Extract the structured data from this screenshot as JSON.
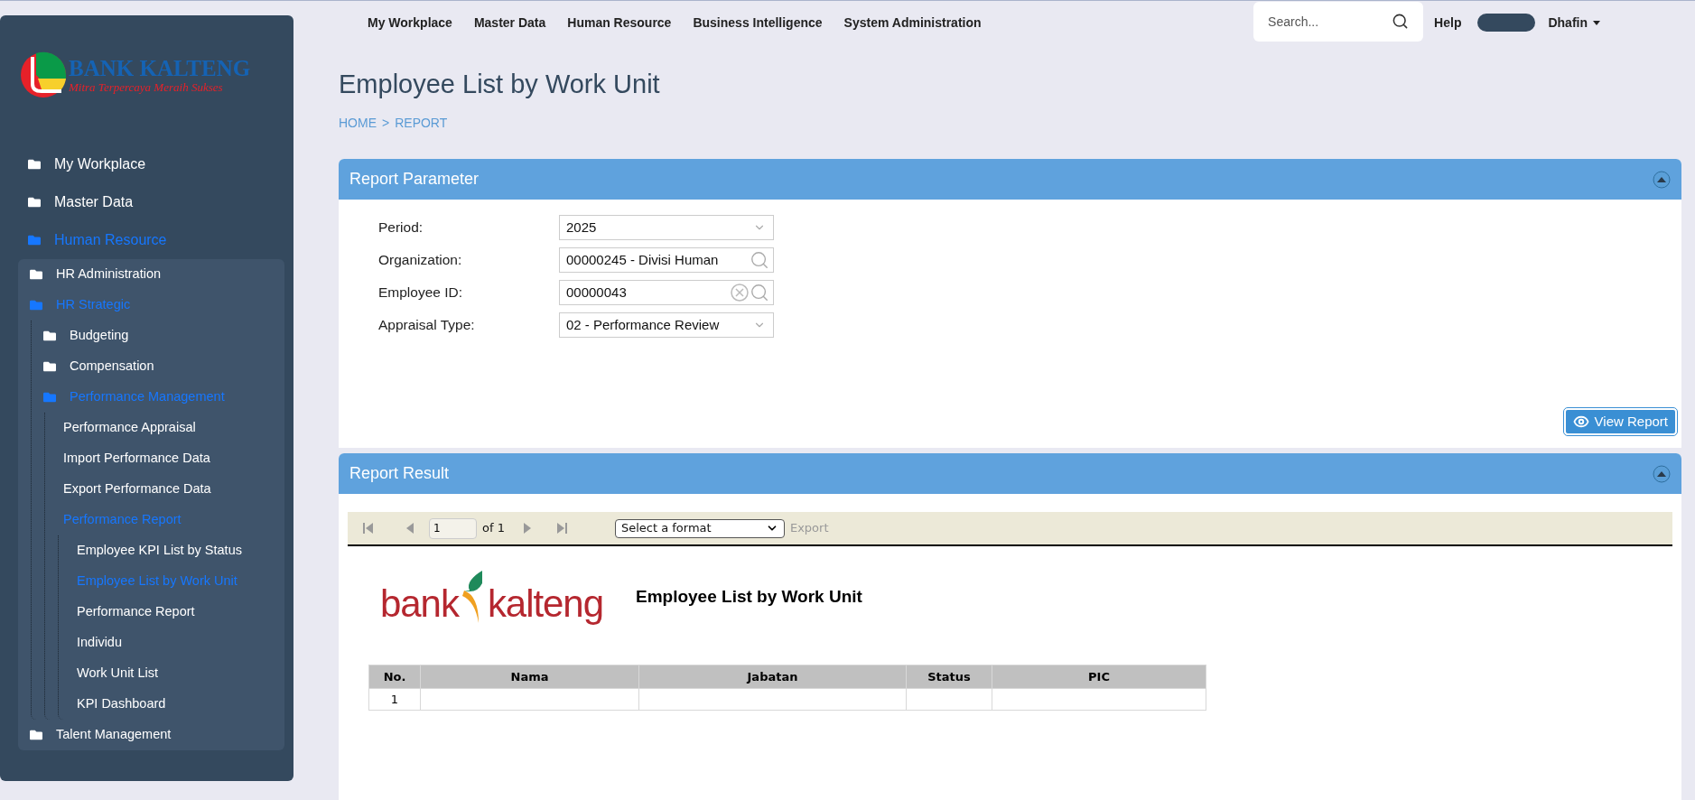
{
  "sidebar": {
    "logo": {
      "name": "BANK KALTENG",
      "tagline": "Mitra Terpercaya Meraih Sukses"
    },
    "items": [
      {
        "label": "My Workplace",
        "kind": "folder",
        "selected": false
      },
      {
        "label": "Master Data",
        "kind": "folder",
        "selected": false
      },
      {
        "label": "Human Resource",
        "kind": "folder",
        "expanded": true,
        "selected": true,
        "children": [
          {
            "label": "HR Administration",
            "kind": "folder",
            "selected": false
          },
          {
            "label": "HR Strategic",
            "kind": "folder",
            "expanded": true,
            "selected": true,
            "children": [
              {
                "label": "Budgeting",
                "kind": "folder",
                "selected": false
              },
              {
                "label": "Compensation",
                "kind": "folder",
                "selected": false
              },
              {
                "label": "Performance Management",
                "kind": "folder",
                "expanded": true,
                "selected": true,
                "children": [
                  {
                    "label": "Performance Appraisal",
                    "kind": "page",
                    "selected": false
                  },
                  {
                    "label": "Import Performance Data",
                    "kind": "page",
                    "selected": false
                  },
                  {
                    "label": "Export Performance Data",
                    "kind": "page",
                    "selected": false
                  },
                  {
                    "label": "Performance Report",
                    "kind": "page",
                    "expanded": true,
                    "selected": true,
                    "children": [
                      {
                        "label": "Employee KPI List by Status",
                        "kind": "page",
                        "selected": false
                      },
                      {
                        "label": "Employee List by Work Unit",
                        "kind": "page",
                        "selected": true
                      },
                      {
                        "label": "Performance Report",
                        "kind": "page",
                        "selected": false
                      },
                      {
                        "label": "Individu",
                        "kind": "page",
                        "selected": false
                      },
                      {
                        "label": "Work Unit List",
                        "kind": "page",
                        "selected": false
                      },
                      {
                        "label": "KPI Dashboard",
                        "kind": "page",
                        "selected": false
                      }
                    ]
                  }
                ]
              }
            ]
          },
          {
            "label": "Talent Management",
            "kind": "folder",
            "selected": false
          }
        ]
      }
    ]
  },
  "top_nav": {
    "items": [
      "My Workplace",
      "Master Data",
      "Human Resource",
      "Business Intelligence",
      "System Administration"
    ],
    "search": {
      "placeholder": "Search..."
    },
    "help": "Help",
    "user": "Dhafin"
  },
  "page": {
    "title": "Employee List by Work Unit",
    "breadcrumb": [
      "HOME",
      "REPORT"
    ],
    "separator": ">"
  },
  "report_parameter": {
    "title": "Report Parameter",
    "fields": [
      {
        "label": "Period:",
        "value": "2025",
        "kind": "select"
      },
      {
        "label": "Organization:",
        "value": "00000245 - Divisi Human",
        "kind": "lookup"
      },
      {
        "label": "Employee ID:",
        "value": "00000043",
        "kind": "lookup_clear"
      },
      {
        "label": "Appraisal Type:",
        "value": "02 - Performance Review",
        "kind": "select"
      }
    ],
    "button": "View Report"
  },
  "report_result": {
    "title": "Report Result",
    "toolbar": {
      "page": "1",
      "of": "of 1",
      "format": "Select a format",
      "export": "Export"
    },
    "report": {
      "logo": [
        "bank",
        "kalteng"
      ],
      "title": "Employee List by Work Unit",
      "columns": [
        "No.",
        "Nama",
        "Jabatan",
        "Status",
        "PIC"
      ],
      "rows": [
        [
          "1"
        ]
      ]
    }
  }
}
